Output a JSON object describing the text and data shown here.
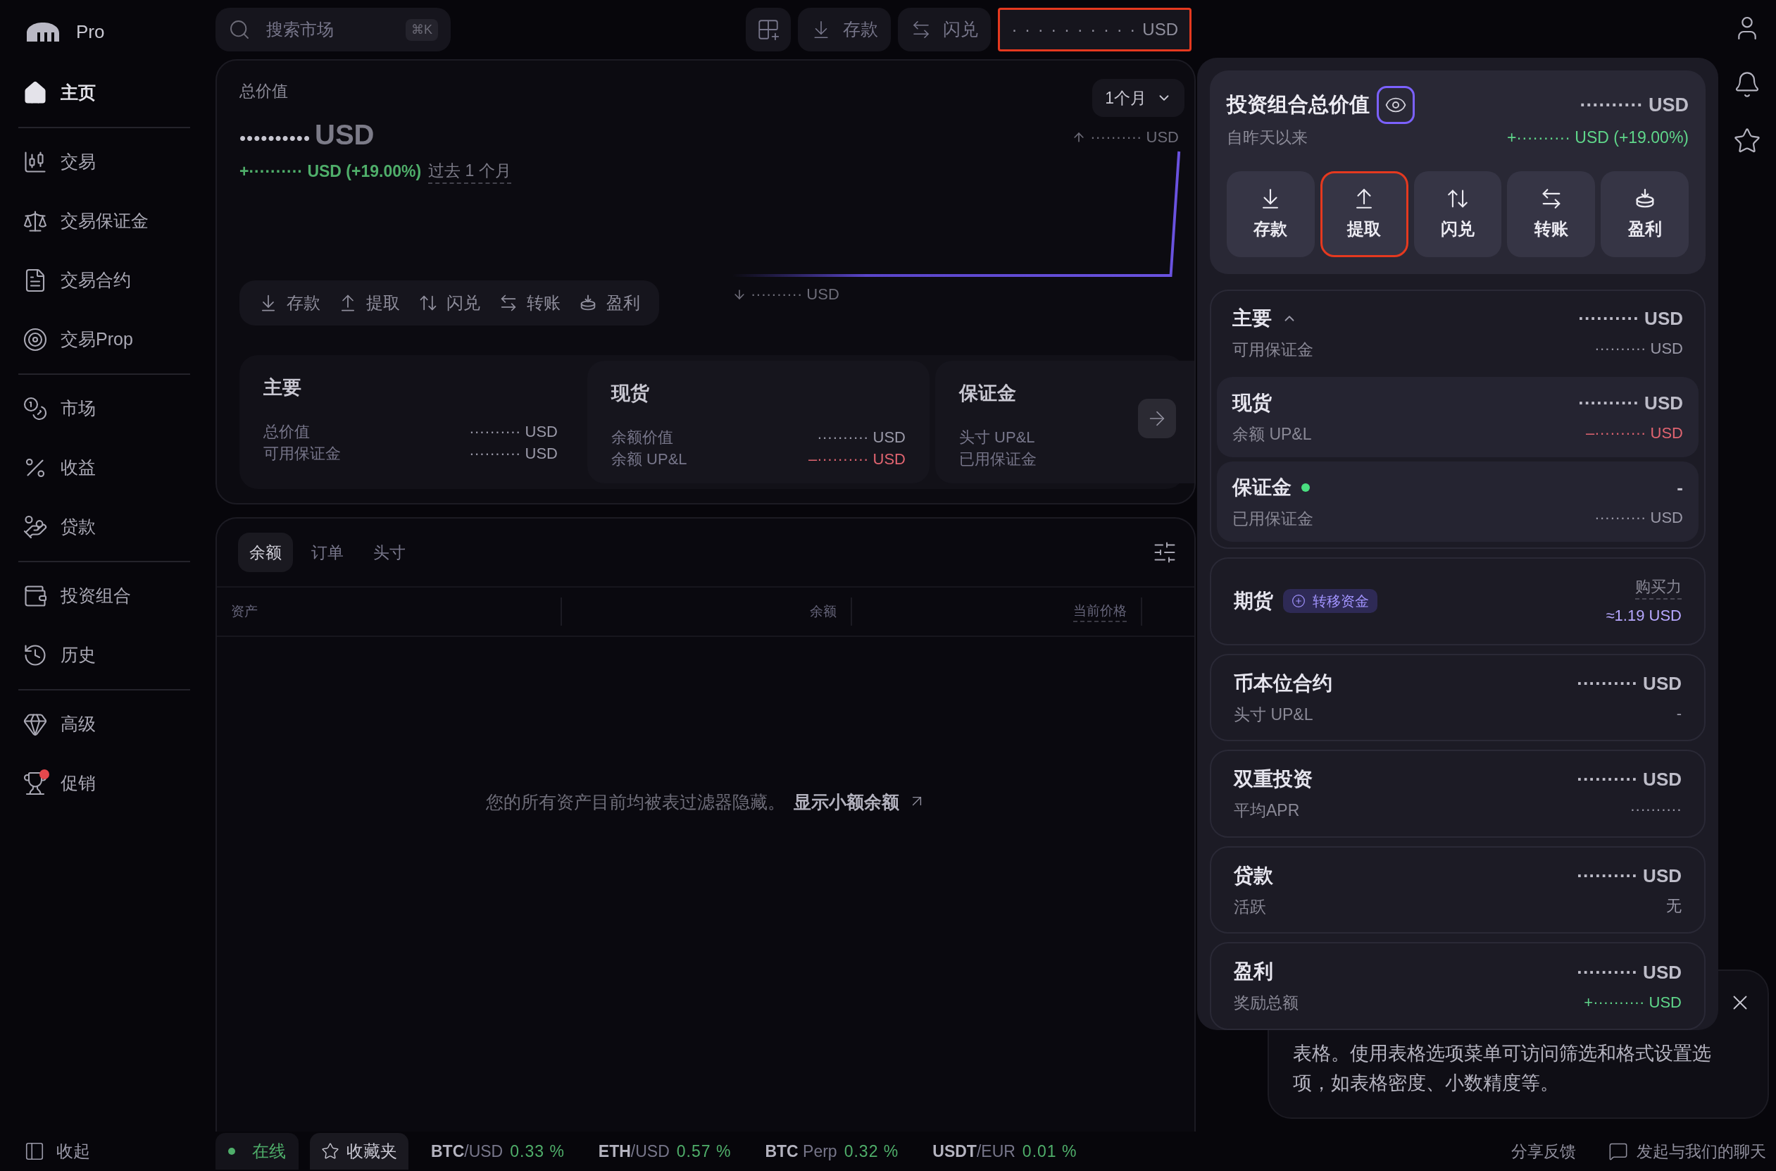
{
  "sidebar": {
    "logo": "Pro",
    "groups": [
      [
        {
          "label": "主页",
          "selected": true,
          "badge": false
        }
      ],
      [
        {
          "label": "交易",
          "selected": false,
          "badge": false
        },
        {
          "label": "交易保证金",
          "selected": false,
          "badge": false
        },
        {
          "label": "交易合约",
          "selected": false,
          "badge": false
        },
        {
          "label": "交易Prop",
          "selected": false,
          "badge": false
        }
      ],
      [
        {
          "label": "市场",
          "selected": false,
          "badge": false
        },
        {
          "label": "收益",
          "selected": false,
          "badge": false
        },
        {
          "label": "贷款",
          "selected": false,
          "badge": false
        }
      ],
      [
        {
          "label": "投资组合",
          "selected": false,
          "badge": false
        },
        {
          "label": "历史",
          "selected": false,
          "badge": false
        }
      ],
      [
        {
          "label": "高级",
          "selected": false,
          "badge": false
        },
        {
          "label": "促销",
          "selected": false,
          "badge": true
        }
      ]
    ],
    "collapse": "收起"
  },
  "search": {
    "placeholder": "搜索市场",
    "shortcut": "⌘K"
  },
  "top_buttons": [
    "存款",
    "闪兑"
  ],
  "balance": {
    "value": "· · · · · · · · · ·",
    "currency": "USD",
    "highlighted": true
  },
  "overview": {
    "title": "总价值",
    "value": "••••••••••",
    "currency": "USD",
    "change": "+·········· USD (+19.00%)",
    "period": "过去 1 个月",
    "range": "1个月",
    "chart_high": "·········· USD",
    "chart_low": "·········· USD",
    "actions": [
      "存款",
      "提取",
      "闪兑",
      "转账",
      "盈利"
    ],
    "accounts": [
      {
        "title": "主要",
        "rows": [
          {
            "label": "总价值",
            "value": "·········· USD",
            "color": "#9a99a8"
          },
          {
            "label": "可用保证金",
            "value": "·········· USD",
            "color": "#9a99a8"
          }
        ]
      },
      {
        "title": "现货",
        "rows": [
          {
            "label": "余额价值",
            "value": "·········· USD",
            "color": "#9a99a8"
          },
          {
            "label": "余额 UP&L",
            "value": "–·········· USD",
            "color": "#e06470"
          }
        ]
      },
      {
        "title": "保证金",
        "rows": [
          {
            "label": "头寸 UP&L"
          },
          {
            "label": "已用保证金"
          }
        ]
      }
    ]
  },
  "table": {
    "tabs": [
      {
        "label": "余额",
        "selected": true
      },
      {
        "label": "订单",
        "selected": false
      },
      {
        "label": "头寸",
        "selected": false
      }
    ],
    "columns": [
      "资产",
      "余额",
      "当前价格"
    ],
    "empty": "您的所有资产目前均被表过滤器隐藏。",
    "empty_link": "显示小额余额"
  },
  "status_bar": {
    "online": "在线",
    "favorites": "收藏夹",
    "tickers": [
      {
        "base": "BTC",
        "quote": "/USD",
        "change": "0.33 %"
      },
      {
        "base": "ETH",
        "quote": "/USD",
        "change": "0.57 %"
      },
      {
        "base": "BTC",
        "quote": " Perp",
        "change": "0.32 %"
      },
      {
        "base": "USDT",
        "quote": "/EUR",
        "change": "0.01 %"
      }
    ],
    "feedback": "分享反馈",
    "chat": "发起与我们的聊天"
  },
  "portfolio_popup": {
    "title": "投资组合总价值",
    "value": "··········",
    "currency": "USD",
    "since": "自昨天以来",
    "change": "+·········· USD (+19.00%)",
    "actions": [
      {
        "label": "存款",
        "highlighted": false
      },
      {
        "label": "提取",
        "highlighted": true
      },
      {
        "label": "闪兑",
        "highlighted": false
      },
      {
        "label": "转账",
        "highlighted": false
      },
      {
        "label": "盈利",
        "highlighted": false
      }
    ],
    "sections": [
      {
        "title": "主要",
        "expanded": true,
        "value": "·········· USD",
        "sub_label": "可用保证金",
        "sub_value": "·········· USD",
        "color": "#9a99a8",
        "children": [
          {
            "title": "现货",
            "value": "·········· USD",
            "sub_label": "余额 UP&L",
            "sub_value": "–·········· USD",
            "color": "#e06470"
          },
          {
            "title": "保证金",
            "status_dot": true,
            "value": "-",
            "sub_label": "已用保证金",
            "sub_value": "·········· USD",
            "color": "#9a99a8"
          }
        ]
      },
      {
        "title": "期货",
        "badge": "转移资金",
        "sub_label": "购买力",
        "sub_value": "≈1.19 USD",
        "color": "#b7a8ff"
      },
      {
        "title": "币本位合约",
        "value": "·········· USD",
        "sub_label": "头寸 UP&L",
        "sub_value": "-",
        "color": "#9a99a8"
      },
      {
        "title": "双重投资",
        "value": "·········· USD",
        "sub_label": "平均APR",
        "sub_value": "··········",
        "color": "#9a99a8"
      },
      {
        "title": "贷款",
        "value": "·········· USD",
        "sub_label": "活跃",
        "sub_value": "无",
        "color": "#9a99a8"
      },
      {
        "title": "盈利",
        "value": "·········· USD",
        "sub_label": "奖励总额",
        "sub_value": "+·········· USD",
        "color": "#5fd68a"
      }
    ]
  },
  "tooltip": {
    "text": "表格。使用表格选项菜单可访问筛选和格式设置选项，如表格密度、小数精度等。"
  }
}
